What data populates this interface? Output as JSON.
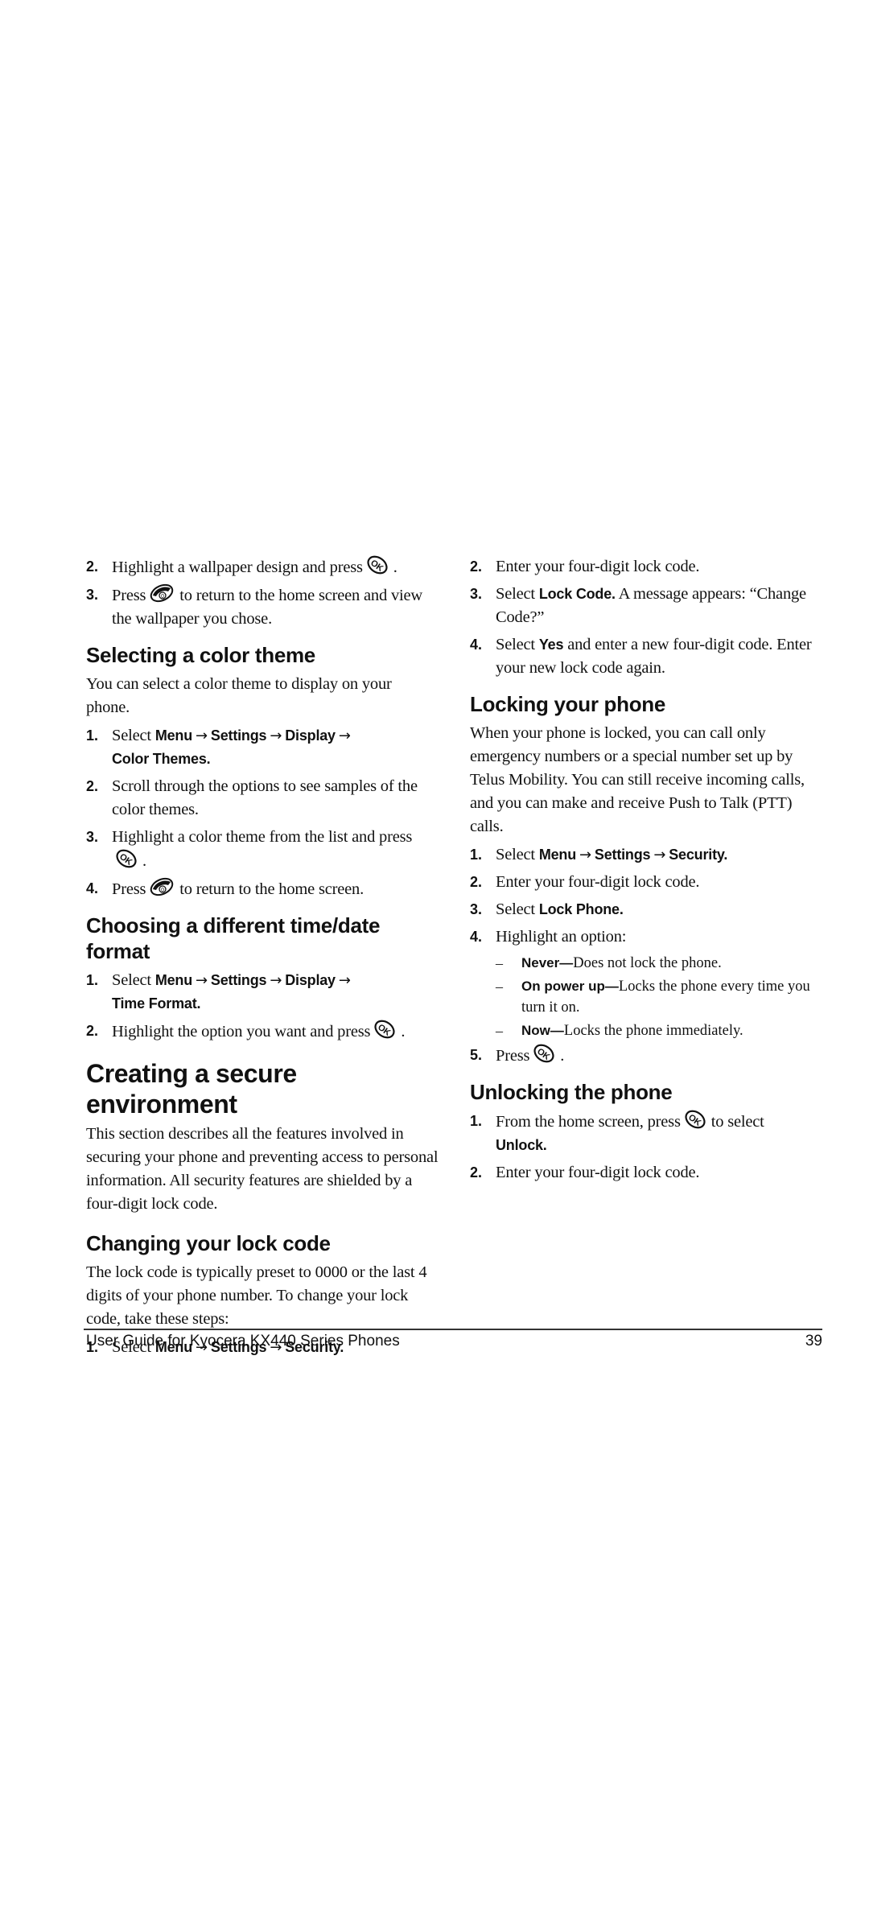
{
  "left_column": {
    "intro_steps": [
      {
        "num": "2.",
        "pre": "Highlight a wallpaper design and press",
        "icon": "ok-key-icon",
        "post": "."
      },
      {
        "num": "3.",
        "pre": "Press",
        "icon": "end-key-icon",
        "post": "to return to the home screen and view the wallpaper you chose."
      }
    ],
    "color_theme": {
      "heading": "Selecting a color theme",
      "body": "You can select a color theme to display on your phone.",
      "steps": [
        {
          "num": "1.",
          "pre": "Select",
          "path": [
            "Menu",
            "Settings",
            "Display",
            "Color Themes."
          ]
        },
        {
          "num": "2.",
          "text": "Scroll through the options to see samples of the color themes."
        },
        {
          "num": "3.",
          "pre": "Highlight a color theme from the list and press",
          "icon": "ok-key-icon",
          "post": "."
        },
        {
          "num": "4.",
          "pre": "Press",
          "icon": "end-key-icon",
          "post": "to return to the home screen."
        }
      ]
    },
    "time_format": {
      "heading": "Choosing a different time/date format",
      "steps": [
        {
          "num": "1.",
          "pre": "Select",
          "path": [
            "Menu",
            "Settings",
            "Display",
            "Time Format."
          ]
        },
        {
          "num": "2.",
          "pre": "Highlight the option you want and press",
          "icon": "ok-key-icon",
          "post": "."
        }
      ]
    },
    "secure": {
      "heading": "Creating a secure environment",
      "body": "This section describes all the features involved in securing your phone and preventing access to personal information. All security features are shielded by a four-digit lock code."
    },
    "lock_code": {
      "heading": "Changing your lock code",
      "body": "The lock code is typically preset to 0000 or the last 4 digits of your phone number. To change your lock code, take these steps:",
      "steps": [
        {
          "num": "1.",
          "pre": "Select",
          "path": [
            "Menu",
            "Settings",
            "Security."
          ]
        }
      ]
    }
  },
  "right_column": {
    "lock_code_cont": [
      {
        "num": "2.",
        "text": "Enter your four-digit lock code."
      },
      {
        "num": "3.",
        "pre": "Select",
        "bold": "Lock Code.",
        "post": "A message appears: “Change Code?”"
      },
      {
        "num": "4.",
        "pre": "Select",
        "bold": "Yes",
        "post": "and enter a new four-digit code. Enter your new lock code again."
      }
    ],
    "locking": {
      "heading": "Locking your phone",
      "body": "When your phone is locked, you can call only emergency numbers or a special number set up by Telus Mobility. You can still receive incoming calls, and you can make and receive Push to Talk (PTT) calls.",
      "steps": [
        {
          "num": "1.",
          "pre": "Select",
          "path": [
            "Menu",
            "Settings",
            "Security."
          ]
        },
        {
          "num": "2.",
          "text": "Enter your four-digit lock code."
        },
        {
          "num": "3.",
          "pre": "Select",
          "bold": "Lock Phone."
        },
        {
          "num": "4.",
          "text": "Highlight an option:"
        }
      ],
      "options": [
        {
          "dash": "–",
          "bold": "Never—",
          "text": "Does not lock the phone."
        },
        {
          "dash": "–",
          "bold": "On power up—",
          "text": "Locks the phone every time you turn it on."
        },
        {
          "dash": "–",
          "bold": "Now—",
          "text": "Locks the phone immediately."
        }
      ],
      "final_step": {
        "num": "5.",
        "pre": "Press",
        "icon": "ok-key-icon",
        "post": "."
      }
    },
    "unlocking": {
      "heading": "Unlocking the phone",
      "steps": [
        {
          "num": "1.",
          "pre": "From the home screen, press",
          "icon": "ok-key-icon",
          "post": "to select",
          "bold": "Unlock."
        },
        {
          "num": "2.",
          "text": "Enter your four-digit lock code."
        }
      ]
    }
  },
  "footer": {
    "title": "User Guide for Kyocera KX440 Series Phones",
    "page_number": "39"
  },
  "arrow_glyph": "→"
}
